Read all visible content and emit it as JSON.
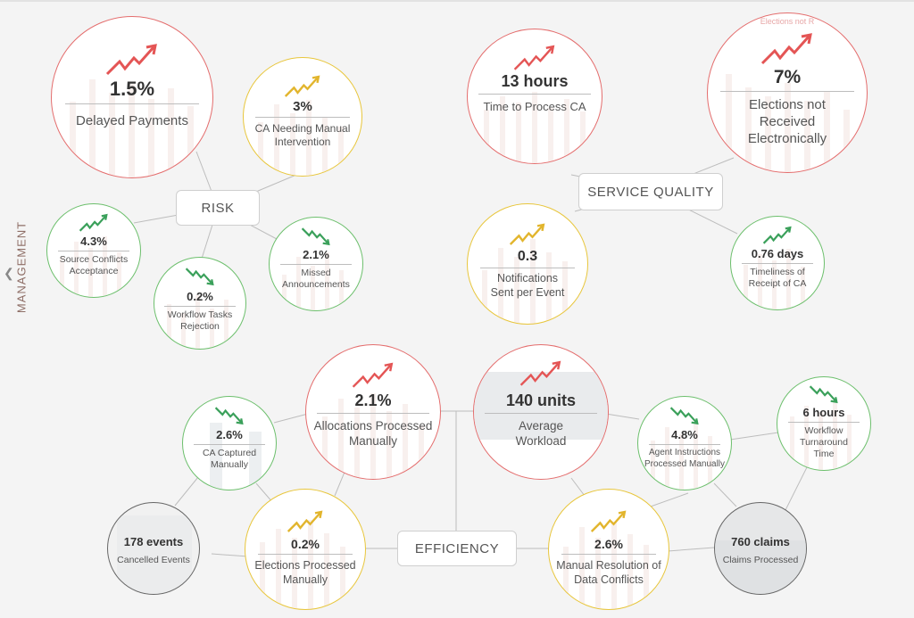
{
  "sidebar": {
    "label": "MANAGEMENT",
    "collapse_icon": "chevron-left-icon"
  },
  "hubs": {
    "risk": "RISK",
    "service": "SERVICE QUALITY",
    "efficiency": "EFFICIENCY"
  },
  "colors": {
    "red": "#e46d6d",
    "yellow": "#e8c63c",
    "green": "#6cbf6c",
    "gray": "#666666"
  },
  "faint_labels": {
    "elections_not_r": "Elections not R"
  },
  "metrics": {
    "delayed_payments": {
      "value": "1.5%",
      "label": "Delayed Payments",
      "trend": "up",
      "status": "red"
    },
    "ca_manual_intervention": {
      "value": "3%",
      "label": "CA Needing Manual Intervention",
      "trend": "up",
      "status": "yellow"
    },
    "source_conflicts": {
      "value": "4.3%",
      "label": "Source Conflicts Acceptance",
      "trend": "up",
      "status": "green"
    },
    "workflow_rejection": {
      "value": "0.2%",
      "label": "Workflow Tasks Rejection",
      "trend": "down",
      "status": "green"
    },
    "missed_announcements": {
      "value": "2.1%",
      "label": "Missed Announcements",
      "trend": "down",
      "status": "green"
    },
    "time_to_process": {
      "value": "13 hours",
      "label": "Time to Process CA",
      "trend": "up",
      "status": "red"
    },
    "elections_not_received": {
      "value": "7%",
      "label": "Elections not Received Electronically",
      "trend": "up",
      "status": "red"
    },
    "notifications": {
      "value": "0.3",
      "label": "Notifications Sent per Event",
      "trend": "up",
      "status": "yellow"
    },
    "timeliness": {
      "value": "0.76 days",
      "label": "Timeliness of Receipt of CA",
      "trend": "up",
      "status": "green"
    },
    "ca_captured": {
      "value": "2.6%",
      "label": "CA Captured Manually",
      "trend": "down",
      "status": "green"
    },
    "allocations": {
      "value": "2.1%",
      "label": "Allocations Processed Manually",
      "trend": "up",
      "status": "red"
    },
    "cancelled_events": {
      "value": "178 events",
      "label": "Cancelled Events",
      "status": "gray"
    },
    "elections_processed": {
      "value": "0.2%",
      "label": "Elections Processed Manually",
      "trend": "up",
      "status": "yellow"
    },
    "average_workload": {
      "value": "140 units",
      "label": "Average Workload",
      "trend": "up",
      "status": "red"
    },
    "agent_instructions": {
      "value": "4.8%",
      "label": "Agent Instructions Processed Manually",
      "trend": "down",
      "status": "green"
    },
    "workflow_turnaround": {
      "value": "6 hours",
      "label": "Workflow Turnaround Time",
      "trend": "down",
      "status": "green"
    },
    "manual_resolution": {
      "value": "2.6%",
      "label": "Manual Resolution of Data Conflicts",
      "trend": "up",
      "status": "yellow"
    },
    "claims_processed": {
      "value": "760 claims",
      "label": "Claims Processed",
      "status": "gray"
    }
  }
}
